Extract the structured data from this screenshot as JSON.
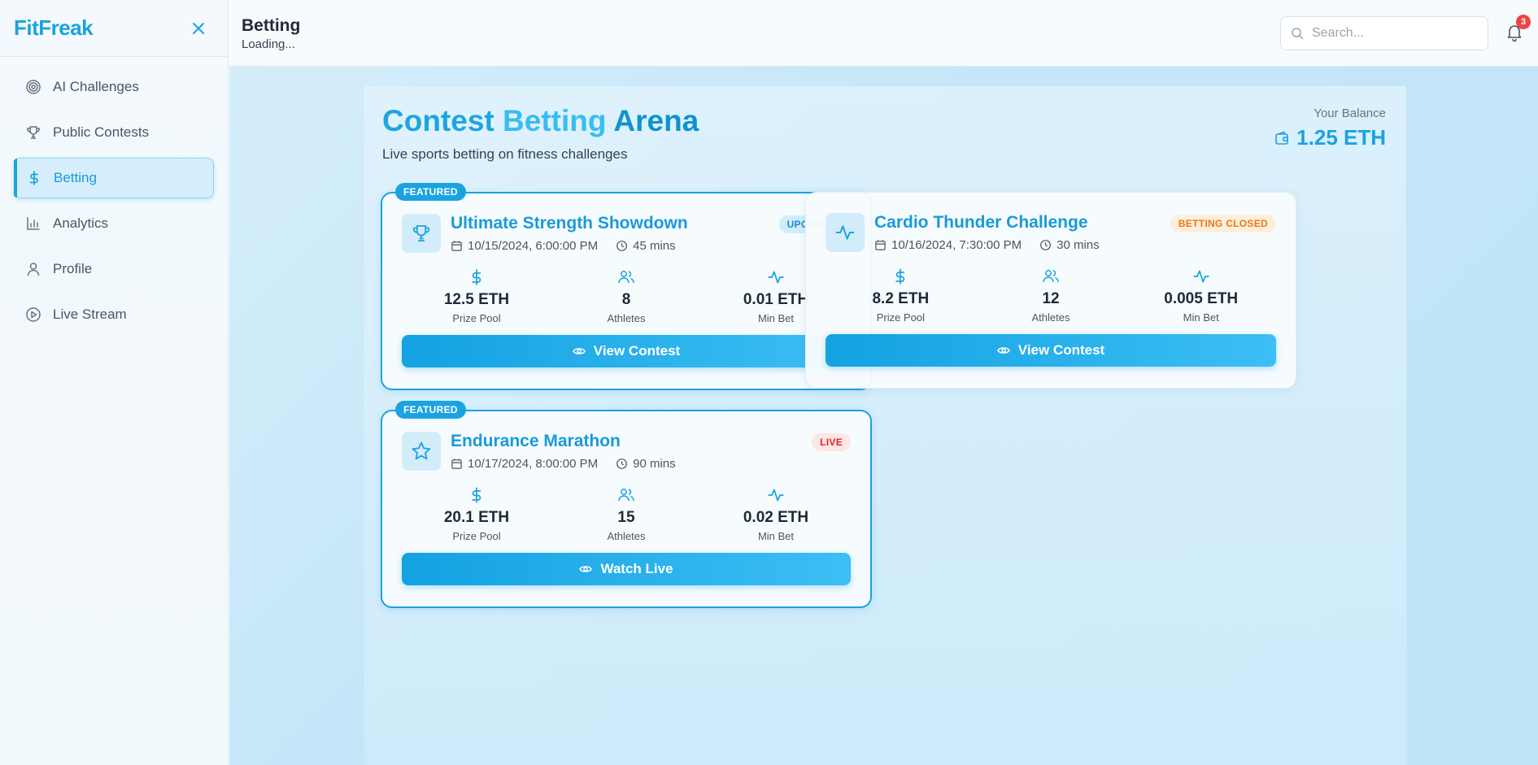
{
  "brand": {
    "name": "FitFreak"
  },
  "sidebar": {
    "items": [
      {
        "label": "AI Challenges",
        "icon": "target-icon"
      },
      {
        "label": "Public Contests",
        "icon": "trophy-icon"
      },
      {
        "label": "Betting",
        "icon": "dollar-icon",
        "active": true
      },
      {
        "label": "Analytics",
        "icon": "bar-chart-icon"
      },
      {
        "label": "Profile",
        "icon": "user-icon"
      },
      {
        "label": "Live Stream",
        "icon": "play-circle-icon"
      }
    ]
  },
  "header": {
    "title": "Betting",
    "subtitle": "Loading...",
    "search_placeholder": "Search...",
    "notification_count": "3"
  },
  "main": {
    "title_parts": [
      "Contest",
      "Betting",
      "Arena"
    ],
    "subtitle": "Live sports betting on fitness challenges",
    "balance_label": "Your Balance",
    "balance_value": "1.25 ETH"
  },
  "contests": [
    {
      "featured_tag": "FEATURED",
      "title": "Ultimate Strength Showdown",
      "icon": "trophy-icon",
      "date": "10/15/2024, 6:00:00 PM",
      "duration": "45 mins",
      "status": "UPCOMING",
      "prize_pool": "12.5 ETH",
      "prize_label": "Prize Pool",
      "athletes": "8",
      "athletes_label": "Athletes",
      "min_bet": "0.01 ETH",
      "min_bet_label": "Min Bet",
      "button": "View Contest"
    },
    {
      "title": "Cardio Thunder Challenge",
      "icon": "activity-icon",
      "date": "10/16/2024, 7:30:00 PM",
      "duration": "30 mins",
      "status": "BETTING CLOSED",
      "prize_pool": "8.2 ETH",
      "prize_label": "Prize Pool",
      "athletes": "12",
      "athletes_label": "Athletes",
      "min_bet": "0.005 ETH",
      "min_bet_label": "Min Bet",
      "button": "View Contest"
    },
    {
      "featured_tag": "FEATURED",
      "title": "Endurance Marathon",
      "icon": "star-icon",
      "date": "10/17/2024, 8:00:00 PM",
      "duration": "90 mins",
      "status": "LIVE",
      "prize_pool": "20.1 ETH",
      "prize_label": "Prize Pool",
      "athletes": "15",
      "athletes_label": "Athletes",
      "min_bet": "0.02 ETH",
      "min_bet_label": "Min Bet",
      "button": "Watch Live"
    }
  ],
  "colors": {
    "accent": "#1aa3e0",
    "live": "#dc2626",
    "closed": "#ea7a14"
  }
}
